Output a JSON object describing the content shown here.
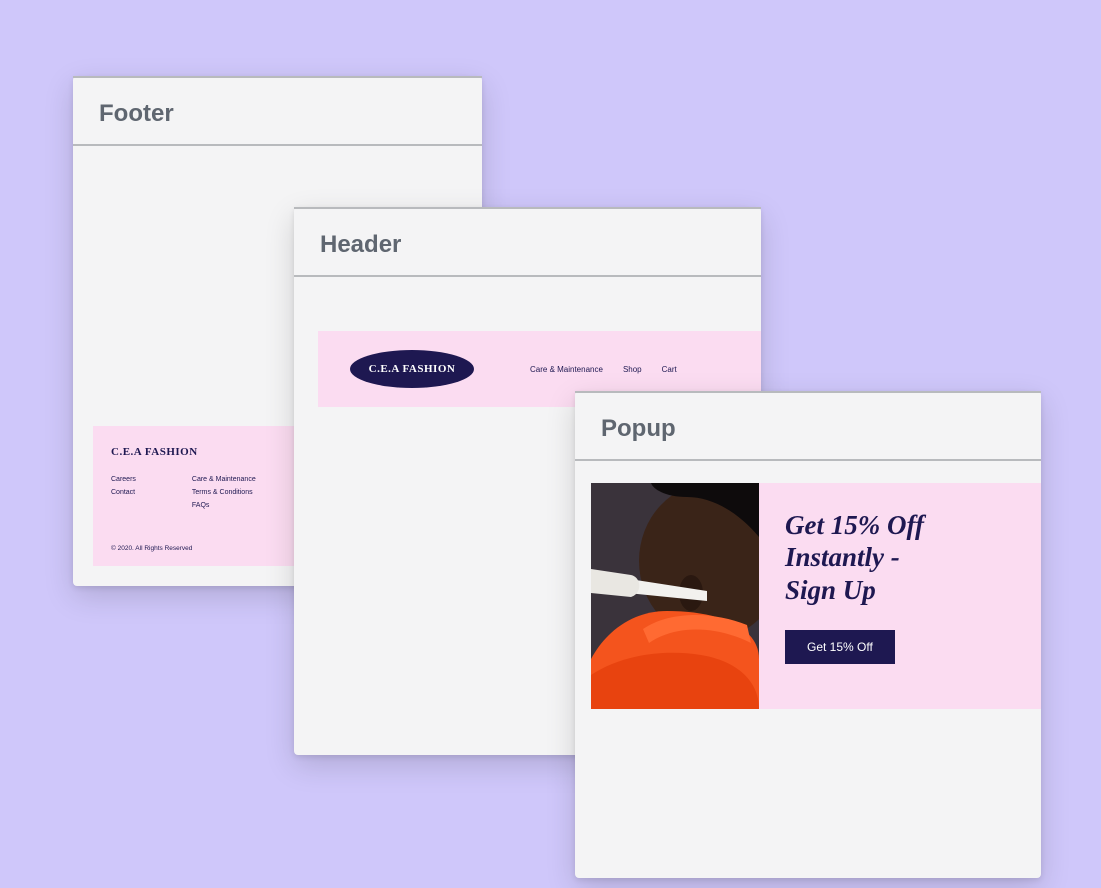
{
  "cards": {
    "footer": {
      "title": "Footer"
    },
    "header": {
      "title": "Header"
    },
    "popup": {
      "title": "Popup"
    }
  },
  "brand": {
    "name": "C.E.A FASHION"
  },
  "footer": {
    "col1": [
      {
        "label": "Careers"
      },
      {
        "label": "Contact"
      }
    ],
    "col2": [
      {
        "label": "Care & Maintenance"
      },
      {
        "label": "Terms & Conditions"
      },
      {
        "label": "FAQs"
      }
    ],
    "copyright": "© 2020. All Rights Reserved"
  },
  "header_nav": [
    {
      "label": "Care & Maintenance"
    },
    {
      "label": "Shop"
    },
    {
      "label": "Cart"
    }
  ],
  "popup": {
    "headline": "Get 15% Off\nInstantly -\nSign Up",
    "cta": "Get 15% Off"
  },
  "colors": {
    "accent_bg": "#FBDCF1",
    "brand_dark": "#1E1851",
    "jacket_orange": "#F4541D"
  }
}
